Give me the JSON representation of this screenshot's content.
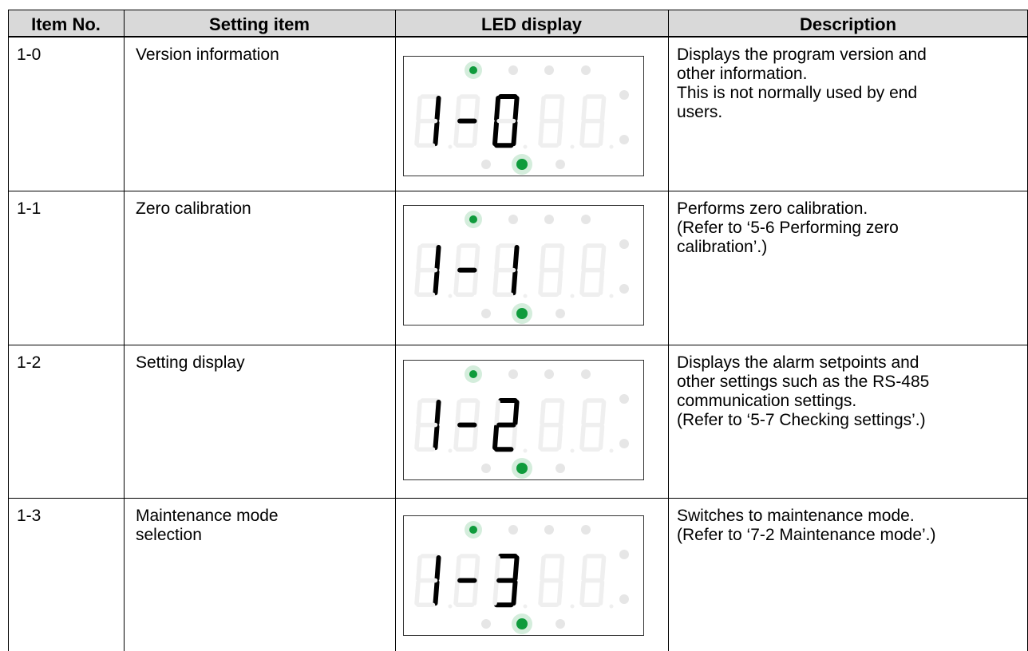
{
  "table": {
    "headers": [
      "Item No.",
      "Setting item",
      "LED display",
      "Description"
    ],
    "rows": [
      {
        "no": "1-0",
        "setting": [
          "Version information"
        ],
        "led": {
          "left": "1",
          "right": "0"
        },
        "description": [
          "Displays the program version and",
          "other information.",
          "This is not normally used by end",
          "users."
        ]
      },
      {
        "no": "1-1",
        "setting": [
          "Zero calibration"
        ],
        "led": {
          "left": "1",
          "right": "1"
        },
        "description": [
          "Performs zero calibration.",
          "(Refer to ‘5-6 Performing zero",
          "calibration’.)"
        ]
      },
      {
        "no": "1-2",
        "setting": [
          "Setting display"
        ],
        "led": {
          "left": "1",
          "right": "2"
        },
        "description": [
          "Displays the alarm setpoints and",
          "other settings such as the RS-485",
          "communication settings.",
          "(Refer to ‘5-7 Checking settings’.)"
        ]
      },
      {
        "no": "1-3",
        "setting": [
          "Maintenance mode",
          "selection"
        ],
        "led": {
          "left": "1",
          "right": "3"
        },
        "description": [
          "Switches to maintenance mode.",
          "(Refer to ‘7-2 Maintenance mode’.)"
        ]
      }
    ]
  },
  "colors": {
    "led_on": "#0f9b3c",
    "led_off": "#e6e6e6",
    "segment_on": "#000000",
    "segment_off": "#efefef",
    "header_bg": "#d9d9d9"
  }
}
